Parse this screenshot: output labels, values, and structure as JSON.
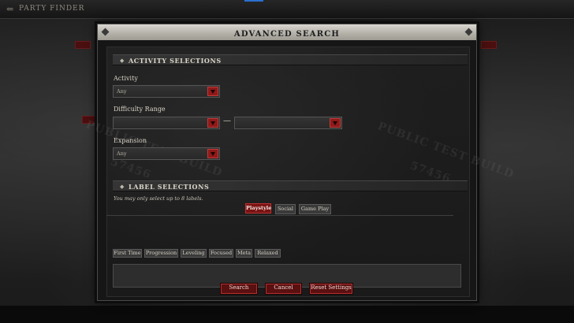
{
  "background": {
    "back_glyph": "⇐",
    "title": "PARTY FINDER",
    "watermark_1": "PUBLIC TEST BUILD",
    "watermark_2": "57456"
  },
  "modal": {
    "title": "ADVANCED SEARCH",
    "activity_section": {
      "title": "ACTIVITY SELECTIONS",
      "activity": {
        "label": "Activity",
        "value": "Any"
      },
      "difficulty": {
        "label": "Difficulty Range",
        "min_value": "",
        "max_value": "",
        "separator": "—"
      },
      "expansion": {
        "label": "Expansion",
        "value": "Any"
      }
    },
    "label_section": {
      "title": "LABEL SELECTIONS",
      "note": "You may only select up to 8 labels.",
      "tabs": [
        {
          "label": "Playstyle",
          "active": true
        },
        {
          "label": "Social",
          "active": false
        },
        {
          "label": "Game Play",
          "active": false
        }
      ],
      "labels": [
        "First Time",
        "Progression",
        "Leveling",
        "Focused",
        "Meta",
        "Relaxed"
      ]
    },
    "buttons": {
      "search": "Search",
      "cancel": "Cancel",
      "reset": "Reset Settings"
    }
  },
  "colors": {
    "accent_red": "#8e1a1a",
    "header_silver": "#c5c2ba",
    "panel_dark": "#1c1c1c"
  }
}
